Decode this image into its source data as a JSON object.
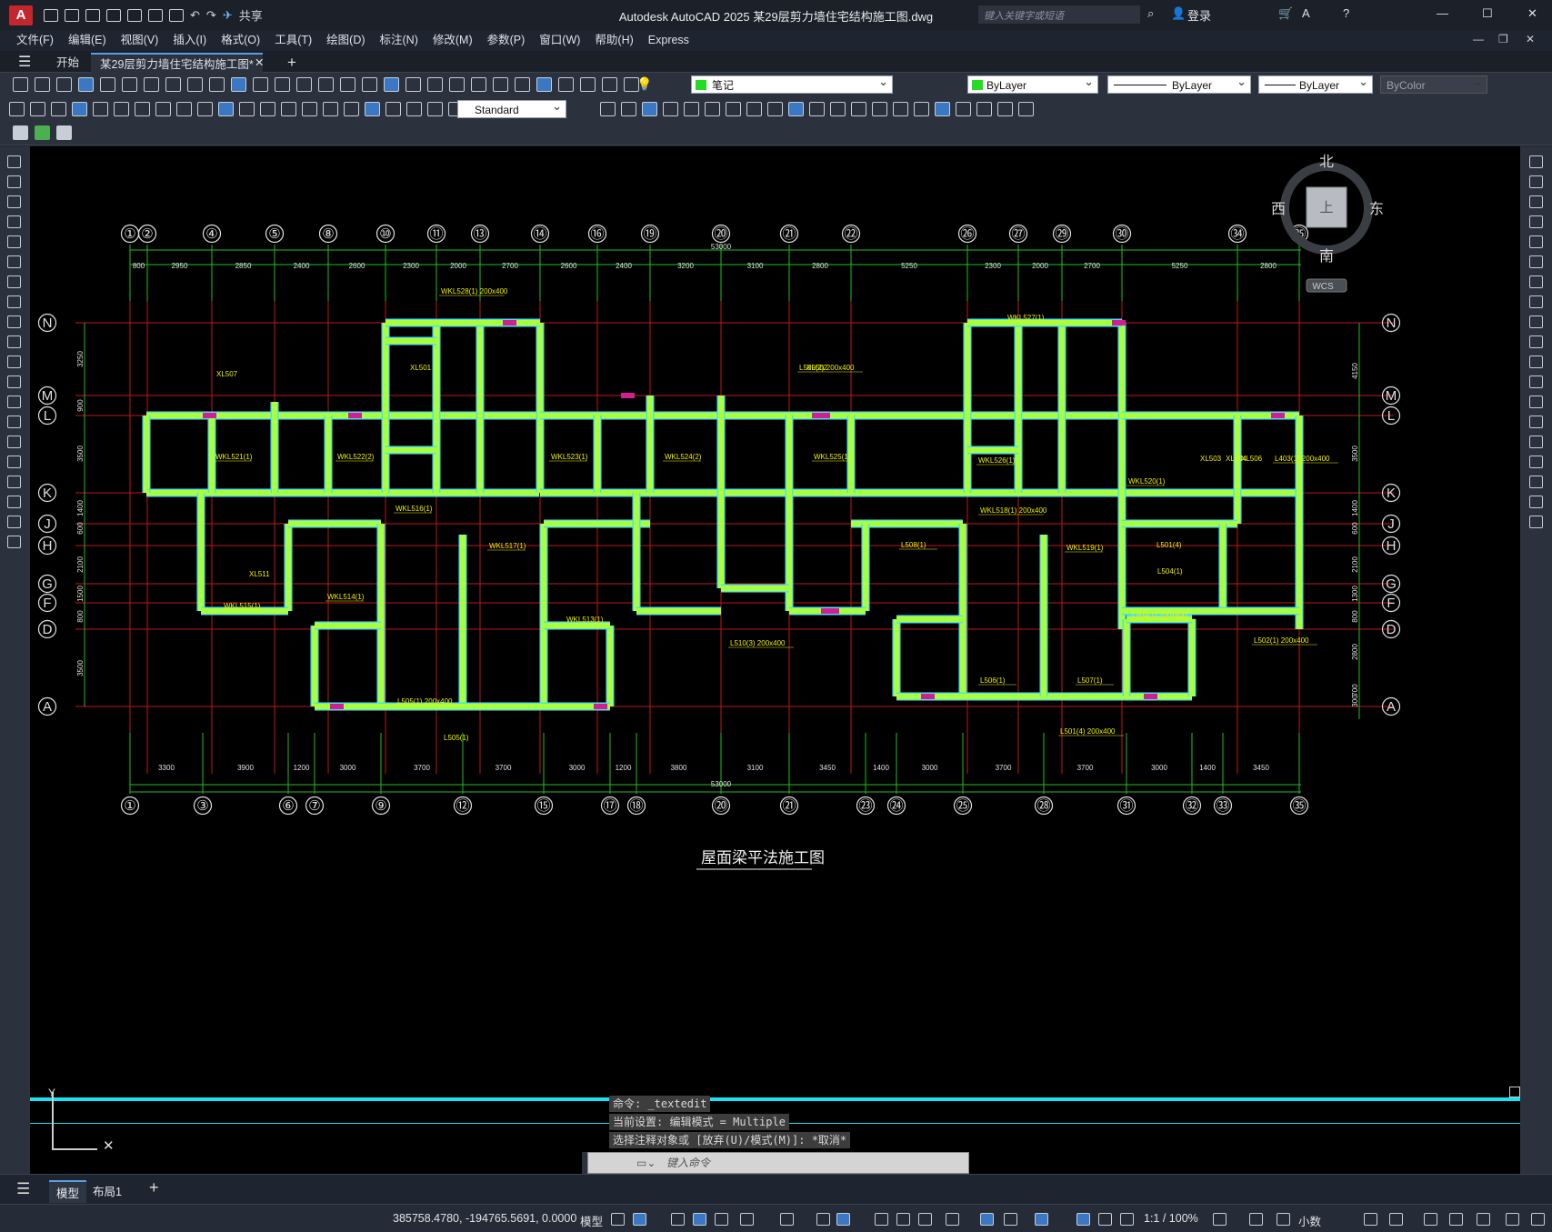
{
  "app": {
    "logo": "A",
    "title": "Autodesk AutoCAD 2025    某29层剪力墙住宅结构施工图.dwg",
    "share": "共享",
    "search_placeholder": "键入关键字或短语",
    "login": "登录"
  },
  "menus": [
    "文件(F)",
    "编辑(E)",
    "视图(V)",
    "插入(I)",
    "格式(O)",
    "工具(T)",
    "绘图(D)",
    "标注(N)",
    "修改(M)",
    "参数(P)",
    "窗口(W)",
    "帮助(H)",
    "Express"
  ],
  "tabs": {
    "start": "开始",
    "doc": "某29层剪力墙住宅结构施工图*"
  },
  "toolbar": {
    "layer": "笔记",
    "color": "ByLayer",
    "linetype": "ByLayer",
    "lineweight": "ByLayer",
    "plotstyle": "ByColor",
    "textstyle": "Standard"
  },
  "viewcube": {
    "north": "北",
    "south": "南",
    "east": "东",
    "west": "西",
    "top": "上",
    "wcs": "WCS"
  },
  "drawing": {
    "caption": "屋面梁平法施工图",
    "top_axes": [
      "①",
      "②",
      "④",
      "⑤",
      "⑧",
      "⑩",
      "⑪",
      "⑬",
      "⑭",
      "⑯",
      "⑲",
      "⑳",
      "㉑",
      "㉒",
      "㉖",
      "㉗",
      "㉙",
      "㉚",
      "㉞",
      "㉟"
    ],
    "bottom_axes": [
      "①",
      "③",
      "⑥",
      "⑦",
      "⑨",
      "⑫",
      "⑮",
      "⑰",
      "⑱",
      "⑳",
      "㉑",
      "㉓",
      "㉔",
      "㉕",
      "㉘",
      "㉛",
      "㉜",
      "㉝",
      "㉟"
    ],
    "row_axes": [
      "N",
      "M",
      "L",
      "K",
      "J",
      "H",
      "G",
      "F",
      "D",
      "A"
    ],
    "top_dims": [
      "800",
      "2950",
      "2850",
      "2400",
      "2600",
      "2300",
      "2000",
      "2700",
      "2600",
      "2400",
      "3200",
      "3100",
      "2800",
      "5250",
      "2300",
      "2000",
      "2700",
      "5250",
      "2800"
    ],
    "bottom_dims": [
      "3300",
      "3900",
      "1200",
      "3000",
      "3700",
      "3700",
      "3000",
      "1200",
      "3800",
      "3100",
      "3450",
      "1400",
      "3000",
      "3700",
      "3700",
      "3000",
      "1400",
      "3450"
    ],
    "total_dim": "53000",
    "left_dims": [
      "3250",
      "900",
      "3500",
      "1400",
      "600",
      "2100",
      "1500",
      "800",
      "3500"
    ],
    "right_dims": [
      "4150",
      "3500",
      "1400",
      "600",
      "2100",
      "1300",
      "800",
      "2800",
      "700",
      "300"
    ],
    "beam_labels": [
      "WKL528(1) 200x400",
      "WKL527(1)",
      "WKL521(1)",
      "WKL522(2)",
      "WKL523(1)",
      "WKL524(2)",
      "WKL525(1)",
      "WKL526(1)",
      "WKL520(1)",
      "WKL516(1)",
      "WKL517(1)",
      "WKL518(1) 200x400",
      "WKL519(1)",
      "WKL515(1)",
      "WKL514(1)",
      "WKL513(1)",
      "L504(1) 200x400",
      "L505(1) 200x400",
      "L506(1)",
      "L507(1)",
      "L508(1)",
      "L509(2) 200x400",
      "L510(3) 200x400",
      "L501(4) 200x400",
      "L502(1) 200x400",
      "L403(1) 200x400",
      "XL501",
      "XL502",
      "XL503",
      "XL504",
      "XL506",
      "XL507",
      "XL511",
      "L504(1)",
      "L505(1)",
      "L501(4)"
    ]
  },
  "command": {
    "lines": [
      "命令: _textedit",
      "当前设置: 编辑模式 = Multiple",
      "选择注释对象或 [放弃(U)/模式(M)]: *取消*"
    ],
    "placeholder": "键入命令"
  },
  "layouts": {
    "model": "模型",
    "layout1": "布局1"
  },
  "status": {
    "coords": "385758.4780, -194765.5691, 0.0000",
    "space": "模型",
    "scale": "1:1 / 100%",
    "units": "小数"
  }
}
